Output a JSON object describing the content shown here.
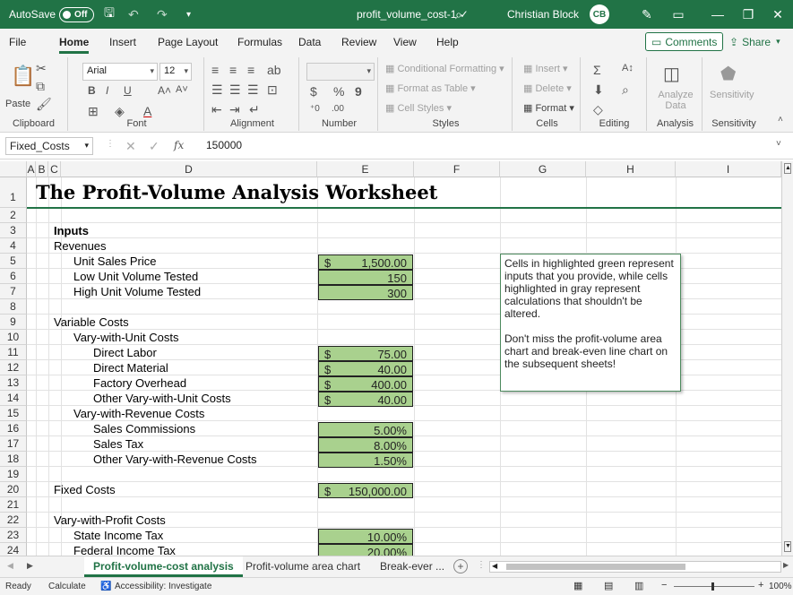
{
  "titlebar": {
    "autosave_label": "AutoSave",
    "autosave_state": "Off",
    "filename": "profit_volume_cost-1 ✓",
    "user_name": "Christian Block",
    "user_initials": "CB"
  },
  "ribbon_tabs": [
    "File",
    "Home",
    "Insert",
    "Page Layout",
    "Formulas",
    "Data",
    "Review",
    "View",
    "Help"
  ],
  "ribbon_buttons": {
    "comments": "Comments",
    "share": "Share"
  },
  "ribbon": {
    "clipboard": {
      "label": "Clipboard",
      "paste": "Paste"
    },
    "font": {
      "label": "Font",
      "name": "Arial",
      "size": "12"
    },
    "alignment": {
      "label": "Alignment"
    },
    "number": {
      "label": "Number",
      "format": "",
      "currency": "$",
      "percent": "%",
      "comma": "9"
    },
    "styles": {
      "label": "Styles",
      "conditional": "Conditional Formatting",
      "table": "Format as Table",
      "cell_styles": "Cell Styles"
    },
    "cells": {
      "label": "Cells",
      "insert": "Insert",
      "delete": "Delete",
      "format": "Format"
    },
    "editing": {
      "label": "Editing"
    },
    "analysis": {
      "label": "Analysis",
      "button": "Analyze Data"
    },
    "sensitivity": {
      "label": "Sensitivity",
      "button": "Sensitivity"
    }
  },
  "formula_bar": {
    "name_box": "Fixed_Costs",
    "fx": "fx",
    "value": "150000"
  },
  "columns": [
    "A",
    "B",
    "C",
    "D",
    "E",
    "F",
    "G",
    "H",
    "I"
  ],
  "rows": [
    "1",
    "2",
    "3",
    "4",
    "5",
    "6",
    "7",
    "8",
    "9",
    "10",
    "11",
    "12",
    "13",
    "14",
    "15",
    "16",
    "17",
    "18",
    "19",
    "20",
    "21",
    "22",
    "23",
    "24"
  ],
  "sheet": {
    "title": "The Profit-Volume Analysis Worksheet",
    "labels": {
      "r3": "Inputs",
      "r4": "Revenues",
      "r5": "Unit Sales Price",
      "r6": "Low Unit Volume Tested",
      "r7": "High Unit Volume Tested",
      "r9": "Variable Costs",
      "r10": "Vary-with-Unit Costs",
      "r11": "Direct Labor",
      "r12": "Direct Material",
      "r13": "Factory Overhead",
      "r14": "Other Vary-with-Unit Costs",
      "r15": "Vary-with-Revenue Costs",
      "r16": "Sales Commissions",
      "r17": "Sales Tax",
      "r18": "Other Vary-with-Revenue Costs",
      "r20": "Fixed Costs",
      "r22": "Vary-with-Profit Costs",
      "r23": "State Income Tax",
      "r24": "Federal Income Tax"
    },
    "values": {
      "r5": {
        "cur": "$",
        "val": "1,500.00"
      },
      "r6": {
        "cur": "",
        "val": "150"
      },
      "r7": {
        "cur": "",
        "val": "300"
      },
      "r11": {
        "cur": "$",
        "val": "75.00"
      },
      "r12": {
        "cur": "$",
        "val": "40.00"
      },
      "r13": {
        "cur": "$",
        "val": "400.00"
      },
      "r14": {
        "cur": "$",
        "val": "40.00"
      },
      "r16": {
        "cur": "",
        "val": "5.00%"
      },
      "r17": {
        "cur": "",
        "val": "8.00%"
      },
      "r18": {
        "cur": "",
        "val": "1.50%"
      },
      "r20": {
        "cur": "$",
        "val": "150,000.00"
      },
      "r23": {
        "cur": "",
        "val": "10.00%"
      },
      "r24": {
        "cur": "",
        "val": "20.00%"
      }
    },
    "note": {
      "p1": "Cells in highlighted green represent inputs that you provide, while cells highlighted in gray represent calculations that shouldn't be altered.",
      "p2": "Don't miss the profit-volume area chart and break-even line chart on the subsequent sheets!"
    }
  },
  "sheet_tabs": [
    "Profit-volume-cost analysis",
    "Profit-volume area chart",
    "Break-ever ..."
  ],
  "status": {
    "mode": "Ready",
    "calc": "Calculate",
    "accessibility": "Accessibility: Investigate",
    "zoom": "100%"
  },
  "colors": {
    "excel_green": "#217346",
    "input_green": "#a9d18e"
  }
}
